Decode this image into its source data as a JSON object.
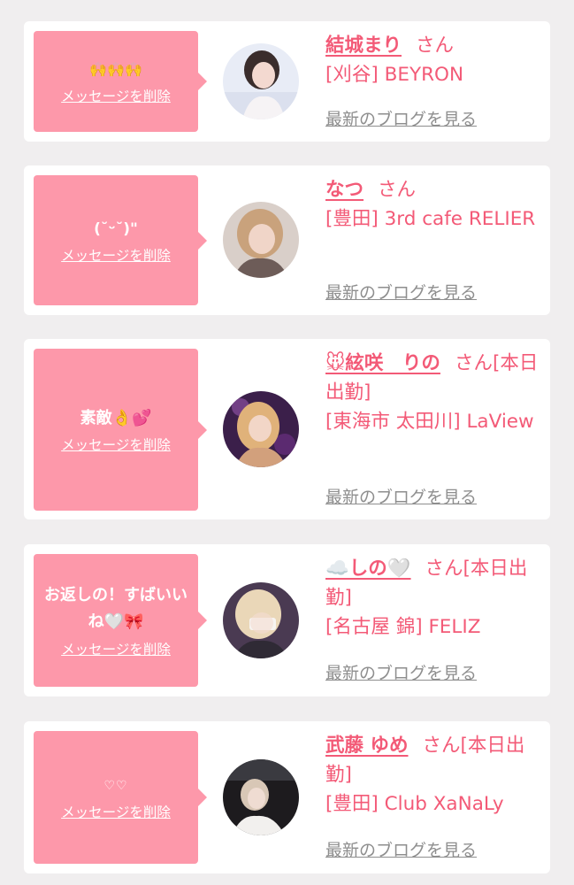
{
  "delete_label": "メッセージを削除",
  "blog_label": "最新のブログを見る",
  "colors": {
    "background": "#f0eeef",
    "card": "#ffffff",
    "bubble": "#fd98aa",
    "accent": "#f35a77",
    "link_gray": "#8e8e8e"
  },
  "messages": [
    {
      "message": "🙌🙌🙌",
      "name": "結城まり",
      "honorific": "さん",
      "store": "[刈谷] BEYRON",
      "avatar_icon": "profile-photo"
    },
    {
      "message": "(˘ᵕ˘)\"",
      "name": "なつ",
      "honorific": "さん",
      "store": "[豊田] 3rd cafe RELIER",
      "avatar_icon": "profile-photo"
    },
    {
      "message": "素敵👌💕",
      "name": "🐭絃咲　りの",
      "honorific": "さん[本日出勤]",
      "store": "[東海市 太田川] LaView",
      "avatar_icon": "profile-photo"
    },
    {
      "message": "お返しの！すばいいね🤍🎀",
      "name": "☁️しの🤍",
      "honorific": "さん[本日出勤]",
      "store": "[名古屋 錦] FELIZ",
      "avatar_icon": "profile-photo"
    },
    {
      "message": "♡♡",
      "name": "武藤 ゆめ",
      "honorific": "さん[本日出勤]",
      "store": "[豊田] Club XaNaLy",
      "avatar_icon": "profile-photo"
    }
  ]
}
